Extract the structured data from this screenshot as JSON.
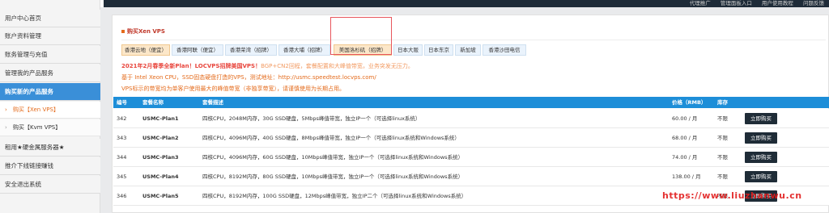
{
  "topbar": {
    "links": [
      "代理推广",
      "管理面板入口",
      "用户使用教程",
      "问题反馈"
    ]
  },
  "sidebar": {
    "items": [
      {
        "label": "用户中心首页"
      },
      {
        "label": "账户资料管理"
      },
      {
        "label": "账务管理与充值"
      },
      {
        "label": "管理我的产品服务"
      },
      {
        "label": "购买新的产品服务"
      }
    ],
    "subitems": [
      {
        "label": "购买【Xen VPS】"
      },
      {
        "label": "购买【Kvm VPS】"
      }
    ],
    "items2": [
      {
        "label": "租用★硬金属服务器★"
      },
      {
        "label": "推介下线链接赚钱"
      },
      {
        "label": "安全退出系统"
      }
    ]
  },
  "panel": {
    "title": "购买Xen VPS"
  },
  "tabs": [
    {
      "label": "香港云地（便宜）"
    },
    {
      "label": "香港阿联（便宜）"
    },
    {
      "label": "香港荣湾（招牌）"
    },
    {
      "label": "香港大埔（招牌）"
    },
    {
      "label": "美国洛杉矶（招牌）"
    },
    {
      "label": "日本大阪"
    },
    {
      "label": "日本东京"
    },
    {
      "label": "新加坡"
    },
    {
      "label": "香港沙田电信"
    }
  ],
  "notice": {
    "line1_bold": "2021年2月春季全新Plan！LOCVPS招牌美国VPS！",
    "line1_rest": "BGP+CN2回程，套餐配置和大峰值带宽，业务突发无压力。",
    "line2": "基于 Intel Xeon CPU，SSD固态硬盘打造的VPS，测试地址：http://usmc.speedtest.locvps.com/",
    "line3": "VPS标示的带宽均为单客户使用最大的峰值带宽（非独享带宽），请谨慎使用为长期占用。"
  },
  "table": {
    "headers": {
      "id": "编号",
      "name": "套餐名称",
      "desc": "套餐描述",
      "price": "价格（RMB）",
      "stock": "库存"
    },
    "rows": [
      {
        "id": "342",
        "name": "USMC-Plan1",
        "desc": "四核CPU，2048M内存，30G SSD硬盘，5Mbps峰值带宽，独立IP一个（可选择linux系统）",
        "price": "60.00 / 月",
        "stock": "不限",
        "buy": "立即购买"
      },
      {
        "id": "343",
        "name": "USMC-Plan2",
        "desc": "四核CPU，4096M内存，40G SSD硬盘，8Mbps峰值带宽，独立IP一个（可选择linux系统和Windows系统）",
        "price": "68.00 / 月",
        "stock": "不限",
        "buy": "立即购买"
      },
      {
        "id": "344",
        "name": "USMC-Plan3",
        "desc": "四核CPU，4096M内存，60G SSD硬盘，10Mbps峰值带宽，独立IP一个（可选择linux系统和Windows系统）",
        "price": "74.00 / 月",
        "stock": "不限",
        "buy": "立即购买"
      },
      {
        "id": "345",
        "name": "USMC-Plan4",
        "desc": "四核CPU，8192M内存，80G SSD硬盘，10Mbps峰值带宽，独立IP一个（可选择linux系统和Windows系统）",
        "price": "138.00 / 月",
        "stock": "不限",
        "buy": "立即购买"
      },
      {
        "id": "346",
        "name": "USMC-Plan5",
        "desc": "四核CPU，8192M内存，100G SSD硬盘，12Mbps峰值带宽，独立IP二个（可选择linux系统和Windows系统）",
        "price": "",
        "stock": "不限",
        "buy": "立即购买"
      }
    ]
  },
  "watermark": "https://www.liuzhanwu.cn"
}
